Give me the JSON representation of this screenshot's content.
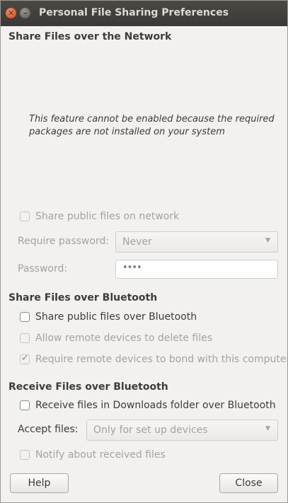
{
  "window": {
    "title": "Personal File Sharing Preferences"
  },
  "network": {
    "heading": "Share Files over the Network",
    "info": "This feature cannot be enabled because the required packages are not installed on your system",
    "share_public_label": "Share public files on network",
    "share_public_checked": false,
    "require_password_label": "Require password:",
    "require_password_value": "Never",
    "password_label": "Password:",
    "password_value": "••••"
  },
  "bluetooth_share": {
    "heading": "Share Files over Bluetooth",
    "share_public_label": "Share public files over Bluetooth",
    "share_public_checked": false,
    "allow_delete_label": "Allow remote devices to delete files",
    "allow_delete_checked": false,
    "require_bond_label": "Require remote devices to bond with this computer",
    "require_bond_checked": true
  },
  "bluetooth_receive": {
    "heading": "Receive Files over Bluetooth",
    "receive_label": "Receive files in Downloads folder over Bluetooth",
    "receive_checked": false,
    "accept_files_label": "Accept files:",
    "accept_files_value": "Only for set up devices",
    "notify_label": "Notify about received files",
    "notify_checked": false
  },
  "buttons": {
    "help": "Help",
    "close": "Close"
  },
  "icons": {
    "close": "close-icon",
    "minimize": "minimize-icon",
    "dropdown": "chevron-down-icon",
    "check": "check-icon"
  },
  "colors": {
    "titlebar": "#3c3b37",
    "close_button": "#e25a2c",
    "window_bg": "#f2f1f0"
  }
}
